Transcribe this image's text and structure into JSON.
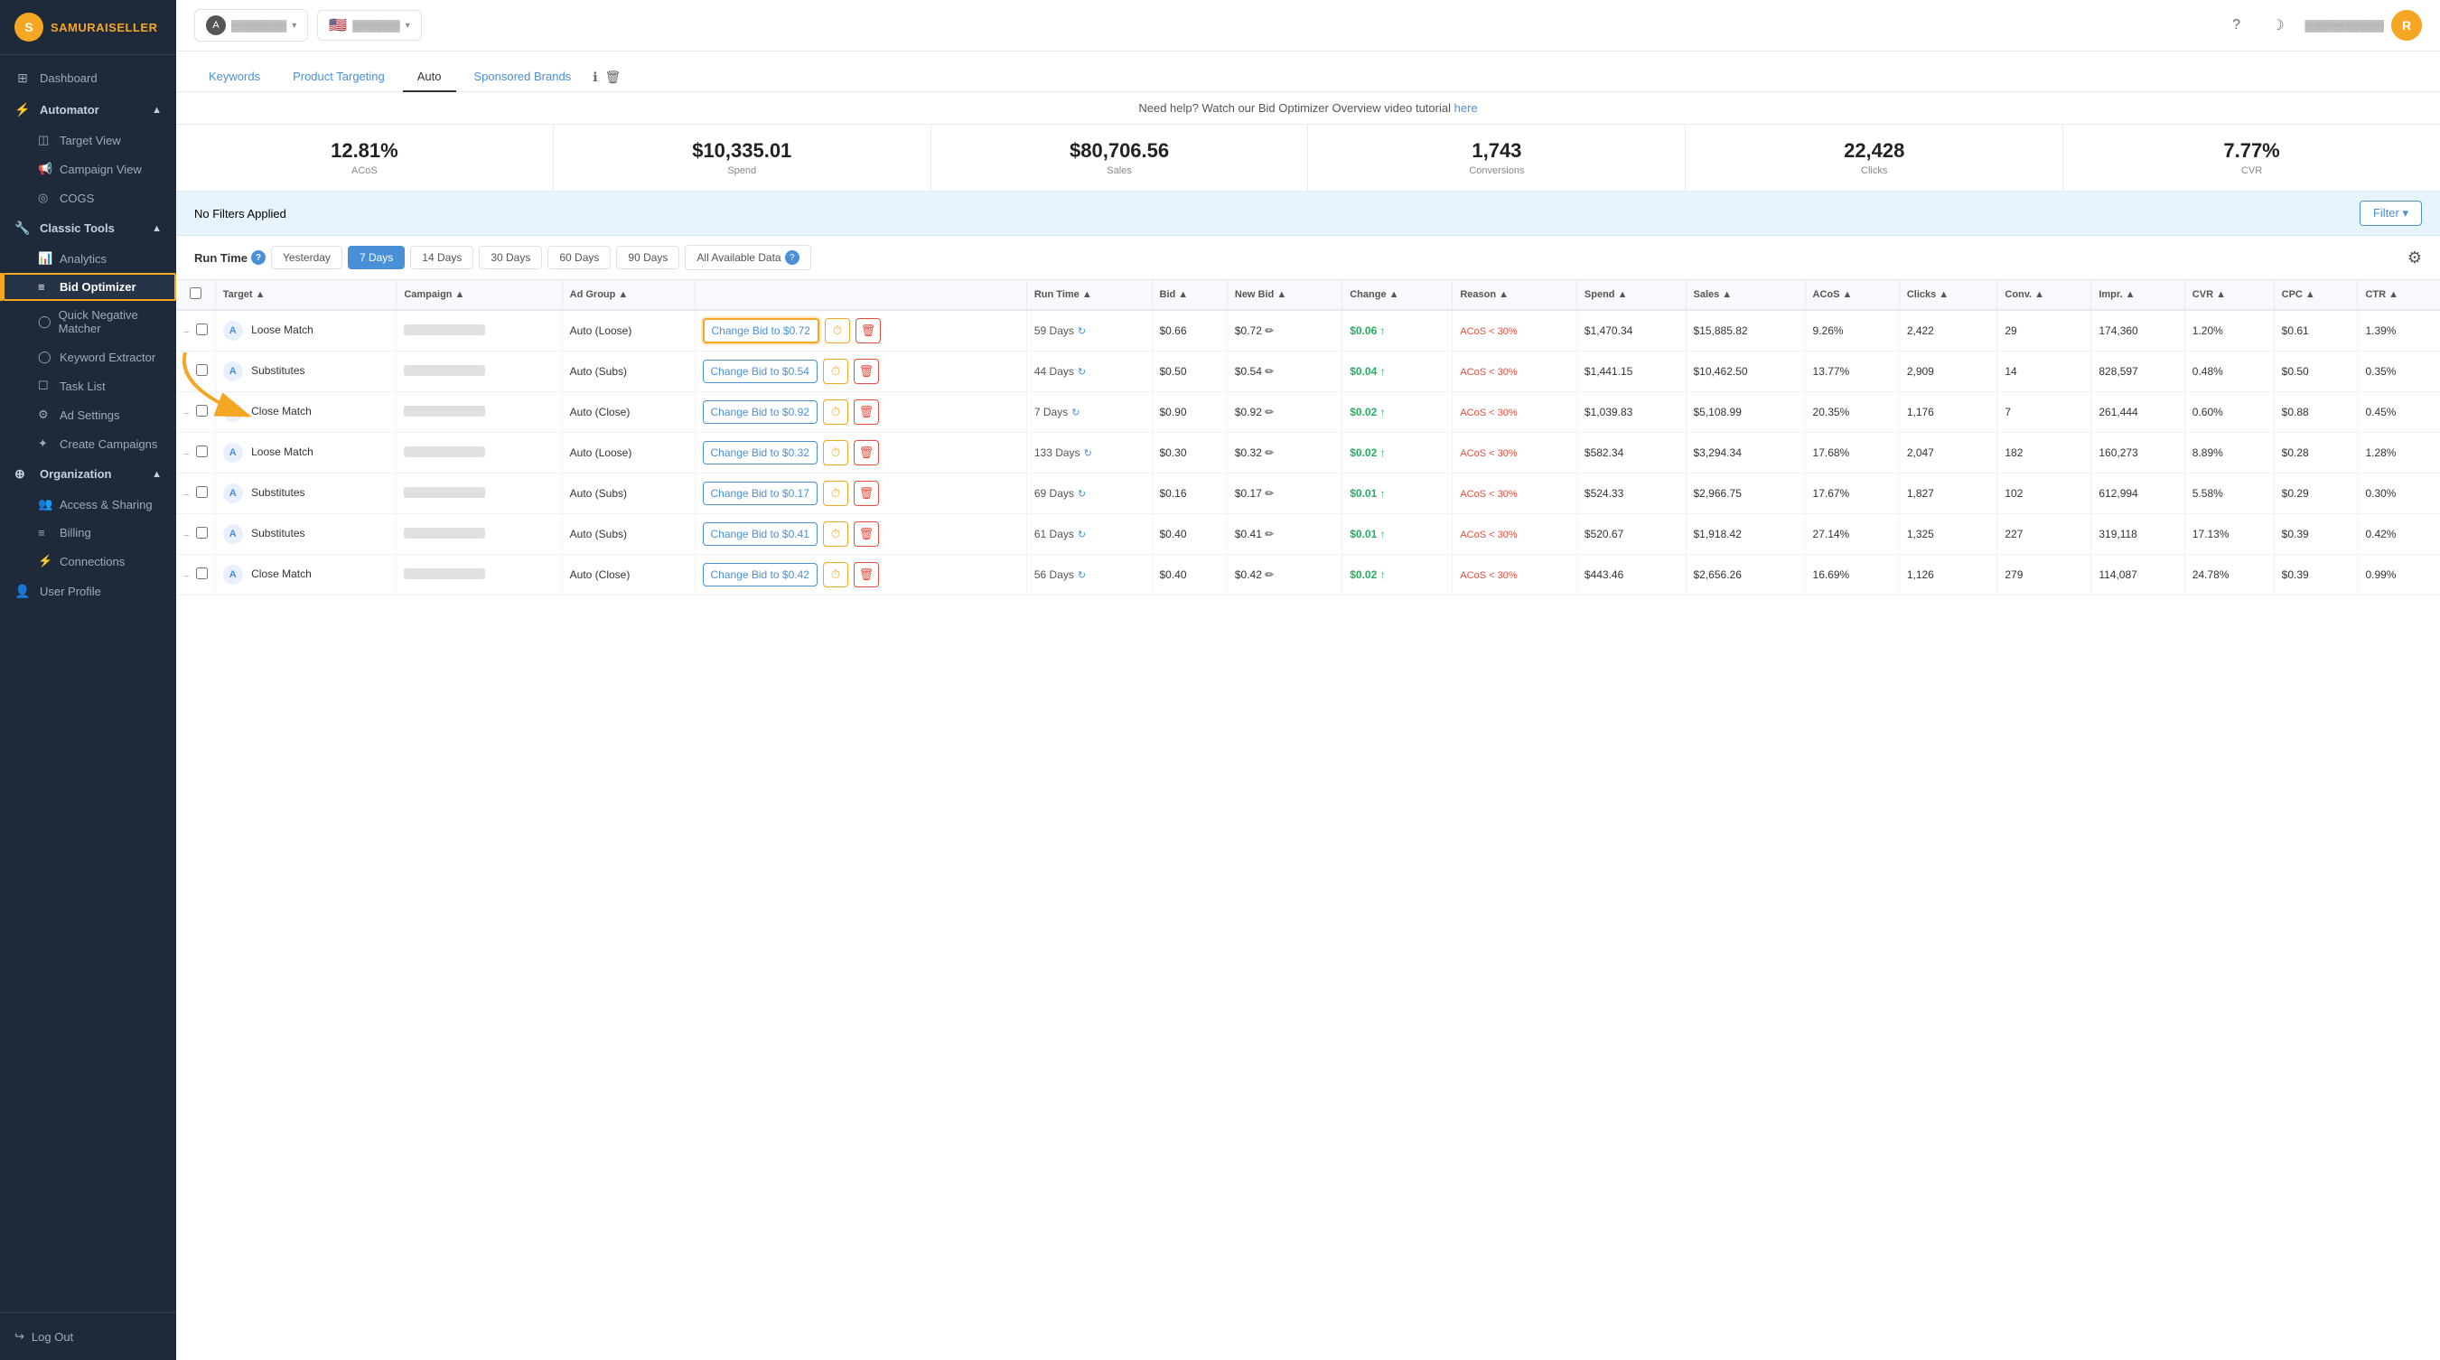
{
  "sidebar": {
    "logo": {
      "icon": "S",
      "text_samurai": "SAMURAI",
      "text_seller": "SELLER"
    },
    "nav": [
      {
        "id": "dashboard",
        "label": "Dashboard",
        "icon": "⊞",
        "type": "item"
      },
      {
        "id": "automator",
        "label": "Automator",
        "icon": "⚡",
        "type": "section",
        "expanded": true
      },
      {
        "id": "target-view",
        "label": "Target View",
        "icon": "◫",
        "type": "sub"
      },
      {
        "id": "campaign-view",
        "label": "Campaign View",
        "icon": "📢",
        "type": "sub"
      },
      {
        "id": "cogs",
        "label": "COGS",
        "icon": "◎",
        "type": "sub"
      },
      {
        "id": "classic-tools",
        "label": "Classic Tools",
        "icon": "🔧",
        "type": "section",
        "expanded": true
      },
      {
        "id": "analytics",
        "label": "Analytics",
        "icon": "📊",
        "type": "sub"
      },
      {
        "id": "bid-optimizer",
        "label": "Bid Optimizer",
        "icon": "≡",
        "type": "sub",
        "active": true
      },
      {
        "id": "quick-negative-matcher",
        "label": "Quick Negative Matcher",
        "icon": "◯",
        "type": "sub"
      },
      {
        "id": "keyword-extractor",
        "label": "Keyword Extractor",
        "icon": "◯",
        "type": "sub"
      },
      {
        "id": "task-list",
        "label": "Task List",
        "icon": "☐",
        "type": "sub"
      },
      {
        "id": "ad-settings",
        "label": "Ad Settings",
        "icon": "⚙",
        "type": "sub"
      },
      {
        "id": "create-campaigns",
        "label": "Create Campaigns",
        "icon": "✦",
        "type": "sub"
      },
      {
        "id": "organization",
        "label": "Organization",
        "icon": "⊕",
        "type": "section",
        "expanded": true
      },
      {
        "id": "access-sharing",
        "label": "Access & Sharing",
        "icon": "👥",
        "type": "sub"
      },
      {
        "id": "billing",
        "label": "Billing",
        "icon": "≡",
        "type": "sub"
      },
      {
        "id": "connections",
        "label": "Connections",
        "icon": "⚡",
        "type": "sub"
      },
      {
        "id": "user-profile",
        "label": "User Profile",
        "icon": "👤",
        "type": "item"
      }
    ],
    "logout": "Log Out"
  },
  "topbar": {
    "dropdown1_placeholder": "Select...",
    "flag": "🇺🇸",
    "dropdown2_placeholder": "Select...",
    "help_icon": "?",
    "moon_icon": "☽",
    "avatar": "R"
  },
  "tabs": [
    {
      "id": "keywords",
      "label": "Keywords",
      "active": false
    },
    {
      "id": "product-targeting",
      "label": "Product Targeting",
      "active": false
    },
    {
      "id": "auto",
      "label": "Auto",
      "active": true
    },
    {
      "id": "sponsored-brands",
      "label": "Sponsored Brands",
      "active": false
    }
  ],
  "help_text": "Need help? Watch our Bid Optimizer Overview video tutorial",
  "help_link": "here",
  "stats": [
    {
      "value": "12.81%",
      "label": "ACoS"
    },
    {
      "value": "$10,335.01",
      "label": "Spend"
    },
    {
      "value": "$80,706.56",
      "label": "Sales"
    },
    {
      "value": "1,743",
      "label": "Conversions"
    },
    {
      "value": "22,428",
      "label": "Clicks"
    },
    {
      "value": "7.77%",
      "label": "CVR"
    }
  ],
  "filter": {
    "text": "No Filters Applied",
    "button": "Filter ▾"
  },
  "runtime": {
    "label": "Run Time",
    "buttons": [
      "Yesterday",
      "7 Days",
      "14 Days",
      "30 Days",
      "60 Days",
      "90 Days",
      "All Available Data"
    ],
    "active": "7 Days"
  },
  "table": {
    "headers": [
      "",
      "Target ▲",
      "Campaign ▲",
      "Ad Group ▲",
      "",
      "Run Time ▲",
      "Bid ▲",
      "New Bid ▲",
      "Change ▲",
      "Reason ▲",
      "Spend ▲",
      "Sales ▲",
      "ACoS ▲",
      "Clicks ▲",
      "Conv. ▲",
      "Impr. ▲",
      "CVR ▲",
      "CPC ▲",
      "CTR ▲"
    ],
    "rows": [
      {
        "expand": "−",
        "target_badge": "A",
        "target": "Loose Match",
        "campaign": "",
        "ad_group": "Auto (Loose)",
        "bid_btn": "Change Bid to $0.72",
        "highlighted": true,
        "run_time": "59 Days",
        "bid": "$0.66",
        "new_bid": "$0.72 ✏",
        "change": "$0.06 ↑",
        "reason": "ACoS < 30%",
        "spend": "$1,470.34",
        "sales": "$15,885.82",
        "acos": "9.26%",
        "clicks": "2,422",
        "conv": "29",
        "impr": "174,360",
        "cvr": "1.20%",
        "cpc": "$0.61",
        "ctr": "1.39%"
      },
      {
        "expand": "−",
        "target_badge": "A",
        "target": "Substitutes",
        "campaign": "",
        "ad_group": "Auto (Subs)",
        "bid_btn": "Change Bid to $0.54",
        "highlighted": false,
        "run_time": "44 Days",
        "bid": "$0.50",
        "new_bid": "$0.54 ✏",
        "change": "$0.04 ↑",
        "reason": "ACoS < 30%",
        "spend": "$1,441.15",
        "sales": "$10,462.50",
        "acos": "13.77%",
        "clicks": "2,909",
        "conv": "14",
        "impr": "828,597",
        "cvr": "0.48%",
        "cpc": "$0.50",
        "ctr": "0.35%"
      },
      {
        "expand": "−",
        "target_badge": "A",
        "target": "Close Match",
        "campaign": "",
        "ad_group": "Auto (Close)",
        "bid_btn": "Change Bid to $0.92",
        "highlighted": false,
        "run_time": "7 Days",
        "bid": "$0.90",
        "new_bid": "$0.92 ✏",
        "change": "$0.02 ↑",
        "reason": "ACoS < 30%",
        "spend": "$1,039.83",
        "sales": "$5,108.99",
        "acos": "20.35%",
        "clicks": "1,176",
        "conv": "7",
        "impr": "261,444",
        "cvr": "0.60%",
        "cpc": "$0.88",
        "ctr": "0.45%"
      },
      {
        "expand": "−",
        "target_badge": "A",
        "target": "Loose Match",
        "campaign": "",
        "ad_group": "Auto (Loose)",
        "bid_btn": "Change Bid to $0.32",
        "highlighted": false,
        "run_time": "133 Days",
        "bid": "$0.30",
        "new_bid": "$0.32 ✏",
        "change": "$0.02 ↑",
        "reason": "ACoS < 30%",
        "spend": "$582.34",
        "sales": "$3,294.34",
        "acos": "17.68%",
        "clicks": "2,047",
        "conv": "182",
        "impr": "160,273",
        "cvr": "8.89%",
        "cpc": "$0.28",
        "ctr": "1.28%"
      },
      {
        "expand": "−",
        "target_badge": "A",
        "target": "Substitutes",
        "campaign": "",
        "ad_group": "Auto (Subs)",
        "bid_btn": "Change Bid to $0.17",
        "highlighted": false,
        "run_time": "69 Days",
        "bid": "$0.16",
        "new_bid": "$0.17 ✏",
        "change": "$0.01 ↑",
        "reason": "ACoS < 30%",
        "spend": "$524.33",
        "sales": "$2,966.75",
        "acos": "17.67%",
        "clicks": "1,827",
        "conv": "102",
        "impr": "612,994",
        "cvr": "5.58%",
        "cpc": "$0.29",
        "ctr": "0.30%"
      },
      {
        "expand": "−",
        "target_badge": "A",
        "target": "Substitutes",
        "campaign": "",
        "ad_group": "Auto (Subs)",
        "bid_btn": "Change Bid to $0.41",
        "highlighted": false,
        "run_time": "61 Days",
        "bid": "$0.40",
        "new_bid": "$0.41 ✏",
        "change": "$0.01 ↑",
        "reason": "ACoS < 30%",
        "spend": "$520.67",
        "sales": "$1,918.42",
        "acos": "27.14%",
        "clicks": "1,325",
        "conv": "227",
        "impr": "319,118",
        "cvr": "17.13%",
        "cpc": "$0.39",
        "ctr": "0.42%"
      },
      {
        "expand": "−",
        "target_badge": "A",
        "target": "Close Match",
        "campaign": "",
        "ad_group": "Auto (Close)",
        "bid_btn": "Change Bid to $0.42",
        "highlighted": false,
        "run_time": "56 Days",
        "bid": "$0.40",
        "new_bid": "$0.42 ✏",
        "change": "$0.02 ↑",
        "reason": "ACoS < 30%",
        "spend": "$443.46",
        "sales": "$2,656.26",
        "acos": "16.69%",
        "clicks": "1,126",
        "conv": "279",
        "impr": "114,087",
        "cvr": "24.78%",
        "cpc": "$0.39",
        "ctr": "0.99%"
      }
    ]
  },
  "arrow_annotation": {
    "visible": true
  }
}
